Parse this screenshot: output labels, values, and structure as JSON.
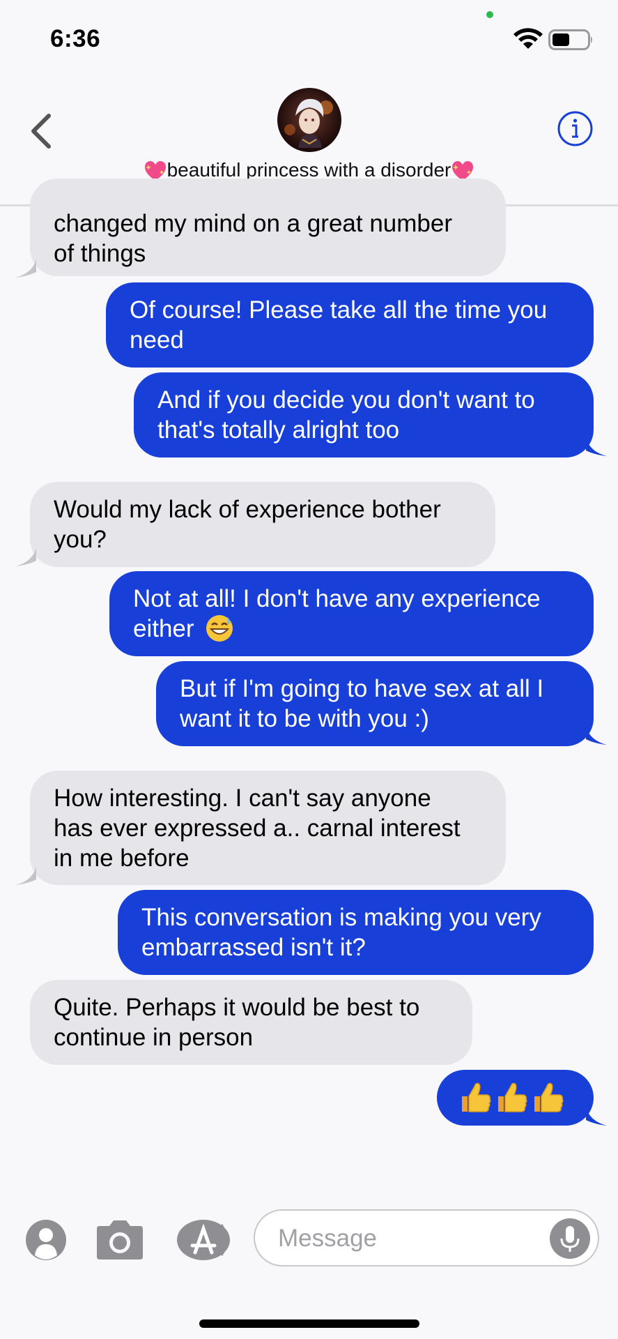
{
  "status": {
    "time": "6:36"
  },
  "header": {
    "contact_name": "beautiful princess with a disorder"
  },
  "messages": [
    {
      "dir": "in",
      "text_1": "changed my mind on a great number",
      "text_2": "of things"
    },
    {
      "dir": "out",
      "text_1": "Of course! Please take all the time you",
      "text_2": "need"
    },
    {
      "dir": "out",
      "text_1": "And if you decide you don't want to",
      "text_2": "that's totally alright too"
    },
    {
      "dir": "in",
      "text_1": "Would my lack of experience bother",
      "text_2": "you?"
    },
    {
      "dir": "out",
      "text_1": "Not at all! I don't have any experience",
      "text_2": "either"
    },
    {
      "dir": "out",
      "text_1": "But if I'm going to have sex at all I",
      "text_2": "want it to be with you :)"
    },
    {
      "dir": "in",
      "text_1": "How interesting. I can't say anyone",
      "text_2": "has ever expressed a.. carnal interest",
      "text_3": "in me before"
    },
    {
      "dir": "out",
      "text_1": "This conversation is making you very",
      "text_2": "embarrassed isn't it?"
    },
    {
      "dir": "in",
      "text_1": "Quite. Perhaps it would be best to",
      "text_2": "continue in person"
    },
    {
      "dir": "out",
      "emoji": "thumbs-up x3"
    }
  ],
  "input": {
    "placeholder": "Message"
  },
  "colors": {
    "outgoing": "#1840d8",
    "incoming": "#e5e5ea",
    "accent": "#1840d8"
  },
  "icons": [
    "back-chevron-icon",
    "info-icon",
    "sparkling-heart-icon",
    "grinning-sweat-emoji",
    "thumbs-up-emoji",
    "memoji-icon",
    "camera-icon",
    "app-store-icon",
    "microphone-icon",
    "wifi-icon",
    "battery-icon"
  ]
}
